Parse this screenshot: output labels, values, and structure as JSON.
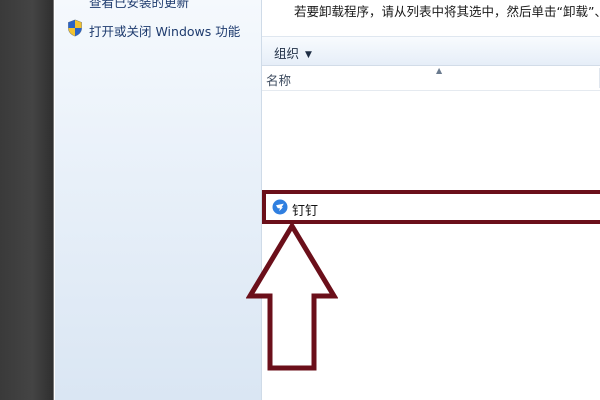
{
  "nav": {
    "links": [
      {
        "label": "查看已安装的更新"
      },
      {
        "label": "打开或关闭 Windows 功能"
      }
    ]
  },
  "main": {
    "instruction": "若要卸载程序，请从列表中将其选中，然后单击“卸载”、",
    "toolbar": {
      "organize_label": "组织",
      "dropdown_glyph": "▼"
    },
    "columns": {
      "name_label": "名称",
      "sort_glyph": "▲"
    },
    "programs": [
      {
        "name": "钉钉",
        "icon": "dingtalk-icon",
        "highlighted": true
      }
    ]
  },
  "callout": {
    "icon": "up-arrow-icon",
    "color": "#6b0f1a"
  },
  "colors": {
    "highlight": "#6b0f1a",
    "link": "#1e3b6e",
    "nav_bg": "#e8f0f9"
  }
}
